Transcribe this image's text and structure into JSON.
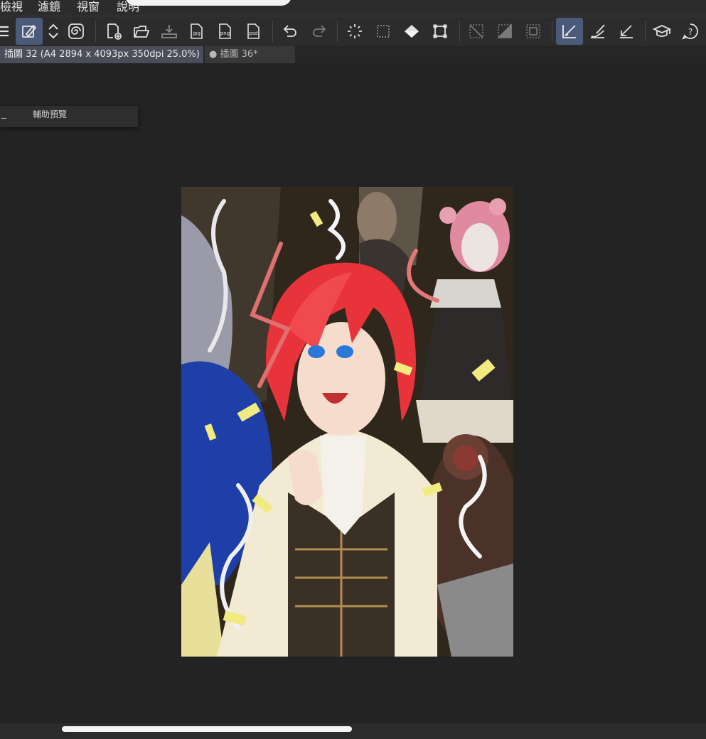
{
  "menubar": {
    "items": [
      "檢視",
      "濾鏡",
      "視窗",
      "說明"
    ]
  },
  "toolbar": {
    "tools": [
      {
        "icon": "hamburger-menu-icon"
      },
      {
        "icon": "brush-settings-icon",
        "active": true
      },
      {
        "icon": "up-down-arrows-icon"
      },
      {
        "icon": "spiral-icon"
      },
      {
        "icon": "new-canvas-icon"
      },
      {
        "icon": "open-folder-icon"
      },
      {
        "icon": "save-icon"
      },
      {
        "icon": "jpg-export-icon",
        "label": "jpg"
      },
      {
        "icon": "png-export-icon",
        "label": "png"
      },
      {
        "icon": "psd-export-icon",
        "label": "psd"
      },
      {
        "icon": "undo-icon"
      },
      {
        "icon": "redo-icon"
      },
      {
        "icon": "loading-spinner-icon"
      },
      {
        "icon": "deselect-icon"
      },
      {
        "icon": "fill-icon"
      },
      {
        "icon": "transform-icon"
      },
      {
        "icon": "clear-selection-icon"
      },
      {
        "icon": "invert-selection-icon"
      },
      {
        "icon": "selection-border-icon"
      },
      {
        "icon": "ruler-pen-icon",
        "active": true
      },
      {
        "icon": "brush-stroke-icon"
      },
      {
        "icon": "ruler-snap-icon"
      },
      {
        "icon": "learn-cap-icon"
      },
      {
        "icon": "help-icon"
      }
    ]
  },
  "tabs": [
    {
      "label": "插圖 32 (A4 2894 x 4093px 350dpi 25.0%)",
      "active": true
    },
    {
      "label": "● 插圖 36*",
      "active": false
    }
  ],
  "panel": {
    "minimize": "_",
    "title": "輔助預覽"
  },
  "colors": {
    "accent": "#4a5a78",
    "background": "#232323",
    "toolbar": "#2c2c2c"
  }
}
